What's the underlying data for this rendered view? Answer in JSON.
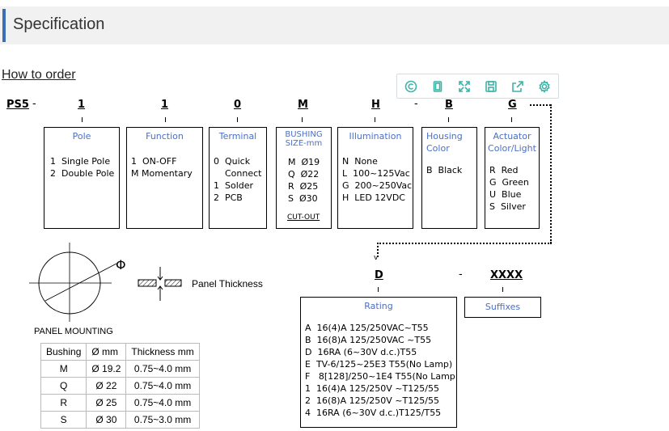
{
  "header": {
    "title": "Specification"
  },
  "how_to_order": "How to order",
  "toolbar": {
    "icons": [
      "copyright-icon",
      "copy-icon",
      "fullscreen-icon",
      "save-icon",
      "share-icon",
      "settings-icon"
    ]
  },
  "code": {
    "prefix": "PS5",
    "sep1": "-",
    "pole": "1",
    "function": "1",
    "terminal": "0",
    "bushing": "M",
    "illumination": "H",
    "sep2": "-",
    "housing": "B",
    "actuator": "G",
    "rating": "D",
    "sep3": "-",
    "suffix": "XXXX"
  },
  "boxes": {
    "pole": {
      "title": "Pole",
      "lines": "1  Single Pole\n2  Double Pole"
    },
    "function": {
      "title": "Function",
      "lines": "1  ON-OFF\nM Momentary"
    },
    "terminal": {
      "title": "Terminal",
      "lines": "0  Quick\n    Connect\n1  Solder\n2  PCB"
    },
    "bushing": {
      "title1": "BUSHING",
      "title2": "SIZE-mm",
      "lines": "M  Ø19\nQ  Ø22\nR  Ø25\nS  Ø30",
      "cutout": "CUT-OUT"
    },
    "illumination": {
      "title": "Illumination",
      "lines": "N  None\nL  100~125Vac\nG  200~250Vac\nH  LED 12VDC"
    },
    "housing": {
      "title1": "Housing",
      "title2": "Color",
      "lines": "B  Black"
    },
    "actuator": {
      "title1": "Actuator",
      "title2": "Color/Light",
      "lines": "R  Red\nG  Green\nU  Blue\nS  Silver"
    },
    "rating": {
      "title": "Rating",
      "lines": "A  16(4)A 125/250VAC~T55\nB  16(8)A 125/250VAC ~T55\nD  16RA (6~30V d.c.)T55\nE  TV-6/125~25E3 T55(No Lamp)\nF   8[128]/250~1E4 T55(No Lamp\n1  16(4)A 125/250V ~T125/55\n2  16(8)A 125/250V ~T125/55\n4  16RA (6~30V d.c.)T125/T55"
    },
    "suffixes": {
      "title": "Suffixes"
    }
  },
  "panel": {
    "phi": "Φ",
    "thickness_label": "Panel Thickness",
    "mounting_label": "PANEL MOUNTING"
  },
  "table": {
    "headers": [
      "Bushing",
      "Ø mm",
      "Thickness mm"
    ],
    "rows": [
      [
        "M",
        "Ø 19.2",
        "0.75~4.0 mm"
      ],
      [
        "Q",
        "Ø 22",
        "0.75~4.0 mm"
      ],
      [
        "R",
        "Ø 25",
        "0.75~4.0 mm"
      ],
      [
        "S",
        "Ø 30",
        "0.75~3.0 mm"
      ]
    ]
  }
}
